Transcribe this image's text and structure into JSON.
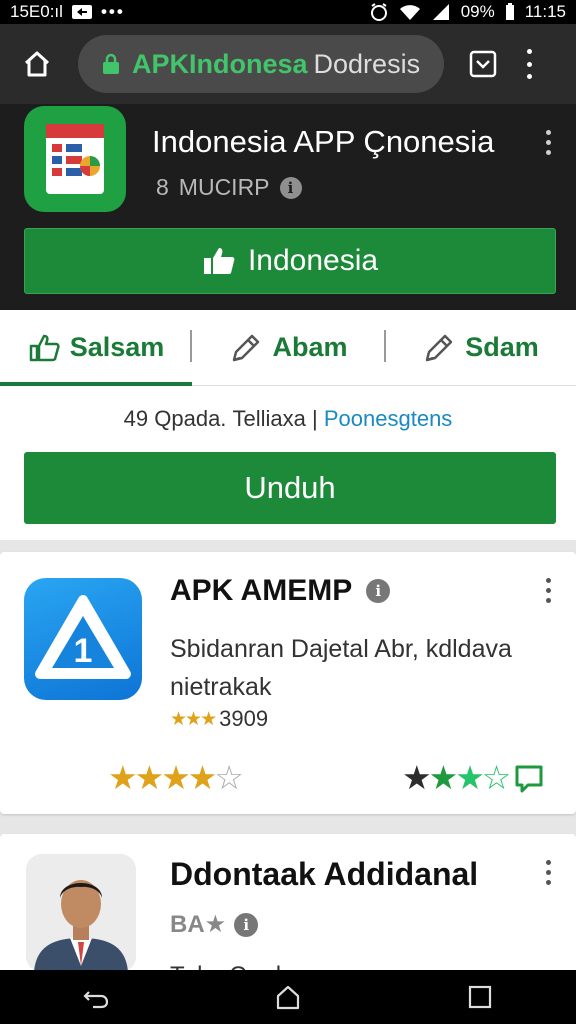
{
  "status_bar": {
    "time_left": "15E0:ıl",
    "battery": "09%",
    "time": "11:15",
    "icons": [
      "signal-icon",
      "app-notification-icon",
      "more-notifications-icon",
      "alarm-icon",
      "wifi-icon",
      "cell-signal-icon",
      "battery-icon"
    ]
  },
  "browser": {
    "url_brand": "APKIndonesa",
    "url_rest": "Dodresis",
    "icons": [
      "home-icon",
      "lock-icon",
      "tab-switcher-icon",
      "overflow-menu-icon"
    ]
  },
  "hero": {
    "title": "Indonesia APP Çnonesia",
    "sub_num": "8",
    "sub_text": "MUCIRP",
    "info": "i",
    "button_label": "Indonesia",
    "accent": "#1d8a3a"
  },
  "tabs": [
    {
      "label": "Salsam",
      "icon": "thumbs-up-icon"
    },
    {
      "label": "Abam",
      "icon": "pen-icon"
    },
    {
      "label": "Sdam",
      "icon": "pen-icon"
    }
  ],
  "stats": {
    "text": "49 Qpadа.  Telliaxa",
    "link": "Poonesgtens"
  },
  "download_button": "Unduh",
  "card1": {
    "title": "APK AMEMP",
    "info": "i",
    "description": "Sbidanran Dajetal Abr, kdldava nietrakak",
    "rating_count": "3909",
    "mini_stars": "★★★",
    "rating": 4,
    "rating_max": 5,
    "right_rating": 3,
    "icon_number": "1"
  },
  "card2": {
    "title": "Ddontaak Addidanal",
    "sub": "BA★",
    "info": "i",
    "partial_text": "Tuka Crad"
  },
  "nav": {
    "icons": [
      "back-icon",
      "home-nav-icon",
      "recents-icon"
    ]
  }
}
